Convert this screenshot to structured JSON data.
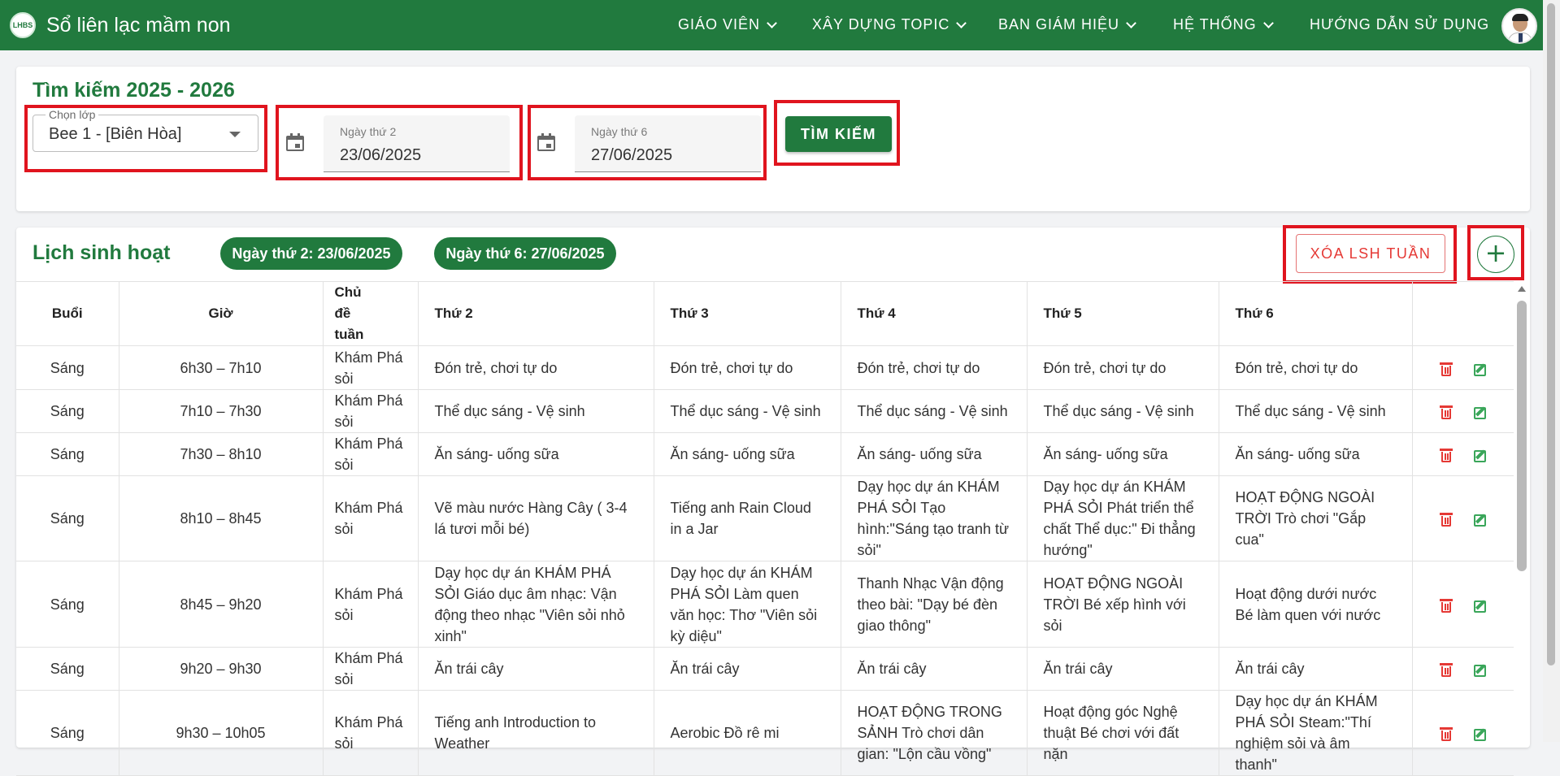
{
  "header": {
    "logo_text": "LHBS",
    "app_title": "Sổ liên lạc mầm non",
    "nav": [
      {
        "label": "GIÁO VIÊN"
      },
      {
        "label": "XÂY DỰNG TOPIC"
      },
      {
        "label": "BAN GIÁM HIỆU"
      },
      {
        "label": "HỆ THỐNG"
      },
      {
        "label": "HƯỚNG DẪN SỬ DỤNG"
      }
    ]
  },
  "search": {
    "title": "Tìm kiếm 2025 - 2026",
    "class_label": "Chọn lớp",
    "class_value": "Bee 1 - [Biên Hòa]",
    "monday_label": "Ngày thứ 2",
    "monday_value": "23/06/2025",
    "friday_label": "Ngày thứ 6",
    "friday_value": "27/06/2025",
    "search_button": "TÌM KIẾM"
  },
  "schedule": {
    "title": "Lịch sinh hoạt",
    "chip_monday": "Ngày thứ 2: 23/06/2025",
    "chip_friday": "Ngày thứ 6: 27/06/2025",
    "delete_week_button": "XÓA LSH TUẦN",
    "add_button": "+",
    "columns": [
      "Buổi",
      "Giờ",
      "Chủ đề tuần",
      "Thứ 2",
      "Thứ 3",
      "Thứ 4",
      "Thứ 5",
      "Thứ 6",
      ""
    ],
    "rows": [
      {
        "session": "Sáng",
        "time": "6h30 – 7h10",
        "topic": "Khám Phá sỏi",
        "mon": "Đón trẻ, chơi tự do",
        "tue": "Đón trẻ, chơi tự do",
        "wed": "Đón trẻ, chơi tự do",
        "thu": "Đón trẻ, chơi tự do",
        "fri": "Đón trẻ, chơi tự do"
      },
      {
        "session": "Sáng",
        "time": "7h10 – 7h30",
        "topic": "Khám Phá sỏi",
        "mon": "Thể dục sáng - Vệ sinh",
        "tue": "Thể dục sáng - Vệ sinh",
        "wed": "Thể dục sáng - Vệ sinh",
        "thu": "Thể dục sáng - Vệ sinh",
        "fri": "Thể dục sáng - Vệ sinh"
      },
      {
        "session": "Sáng",
        "time": "7h30 – 8h10",
        "topic": "Khám Phá sỏi",
        "mon": "Ăn sáng- uống sữa",
        "tue": "Ăn sáng- uống sữa",
        "wed": "Ăn sáng- uống sữa",
        "thu": "Ăn sáng- uống sữa",
        "fri": "Ăn sáng- uống sữa"
      },
      {
        "session": "Sáng",
        "time": "8h10 – 8h45",
        "topic": "Khám Phá sỏi",
        "mon": "Vẽ màu nước Hàng Cây ( 3-4 lá tươi mỗi bé)",
        "tue": "Tiếng anh Rain Cloud in a Jar",
        "wed": "Dạy học dự án KHÁM PHÁ SỎI Tạo hình:\"Sáng tạo tranh từ sỏi\"",
        "thu": "Dạy học dự án KHÁM PHÁ SỎI Phát triển thể chất Thể dục:\" Đi thẳng hướng\"",
        "fri": "HOẠT ĐỘNG NGOÀI TRỜI Trò chơi \"Gắp cua\""
      },
      {
        "session": "Sáng",
        "time": "8h45 – 9h20",
        "topic": "Khám Phá sỏi",
        "mon": "Dạy học dự án KHÁM PHÁ SỎI Giáo dục âm nhạc: Vận động theo nhạc \"Viên sỏi nhỏ xinh\"",
        "tue": "Dạy học dự án KHÁM PHÁ SỎI Làm quen văn học: Thơ \"Viên sỏi kỳ diệu\"",
        "wed": "Thanh Nhạc Vận động theo bài: \"Dạy bé đèn giao thông\"",
        "thu": "HOẠT ĐỘNG NGOÀI TRỜI Bé xếp hình với sỏi",
        "fri": "Hoạt động dưới nước Bé làm quen với nước"
      },
      {
        "session": "Sáng",
        "time": "9h20 – 9h30",
        "topic": "Khám Phá sỏi",
        "mon": "Ăn trái cây",
        "tue": "Ăn trái cây",
        "wed": "Ăn trái cây",
        "thu": "Ăn trái cây",
        "fri": "Ăn trái cây"
      },
      {
        "session": "Sáng",
        "time": "9h30 – 10h05",
        "topic": "Khám Phá sỏi",
        "mon": "Tiếng anh Introduction to Weather",
        "tue": "Aerobic Đồ rê mi",
        "wed": "HOẠT ĐỘNG TRONG SẢNH Trò chơi dân gian: \"Lộn cầu vồng\"",
        "thu": "Hoạt động góc Nghệ thuật Bé chơi với đất nặn",
        "fri": "Dạy học dự án KHÁM PHÁ SỎI Steam:\"Thí nghiệm sỏi và âm thanh\""
      }
    ]
  },
  "colors": {
    "brand_green": "#217a3e",
    "danger_red": "#e53935",
    "highlight_red": "#e0141e"
  },
  "icons": [
    "logo-icon",
    "chevron-down-icon",
    "calendar-icon",
    "plus-icon",
    "trash-icon",
    "edit-icon"
  ]
}
